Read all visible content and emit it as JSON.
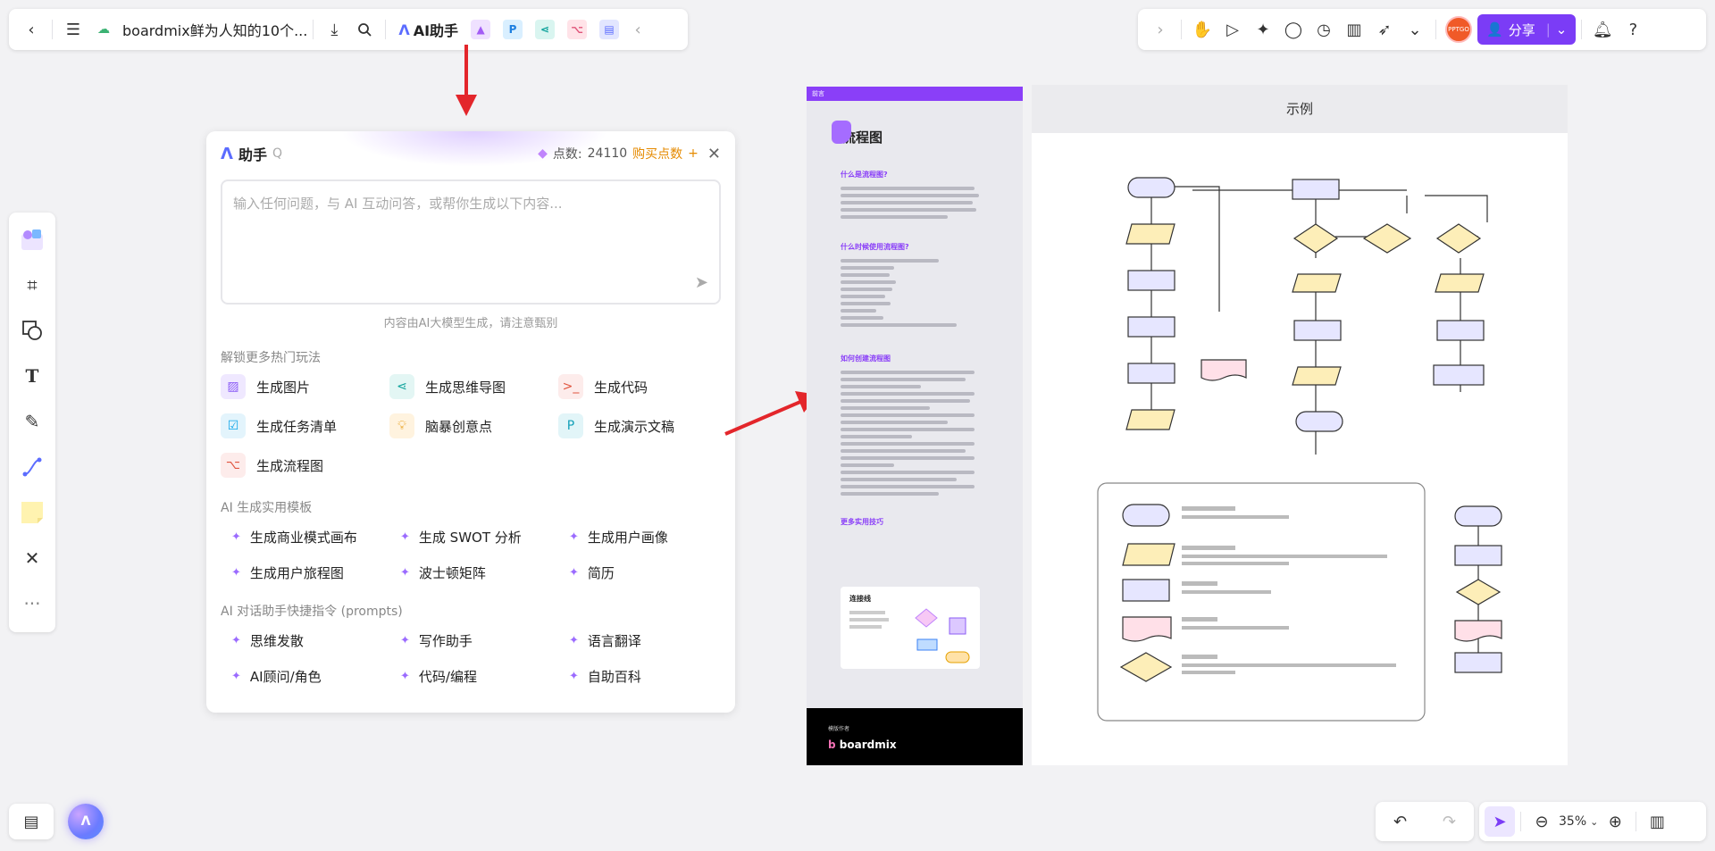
{
  "topbar": {
    "doc_title": "boardmix鲜为人知的10个...",
    "ai_label": "AI助手",
    "share_label": "分享",
    "avatar_text": "PPTGO"
  },
  "ai_panel": {
    "title": "助手",
    "points_label": "点数:",
    "points_value": "24110",
    "buy_label": "购买点数",
    "input_placeholder": "输入任何问题，与 AI 互动问答，或帮你生成以下内容...",
    "disclaimer": "内容由AI大模型生成，请注意甄别",
    "section_hot": "解锁更多热门玩法",
    "hot_items": [
      {
        "label": "生成图片",
        "icon": "image-icon",
        "color": "#8b5cf6",
        "bg": "#efe8ff"
      },
      {
        "label": "生成思维导图",
        "icon": "mindmap-icon",
        "color": "#10a39c",
        "bg": "#e3f6f4"
      },
      {
        "label": "生成代码",
        "icon": "code-icon",
        "color": "#e0553f",
        "bg": "#fdeceb"
      },
      {
        "label": "生成任务清单",
        "icon": "checklist-icon",
        "color": "#0ea5e9",
        "bg": "#e3f4fc"
      },
      {
        "label": "脑暴创意点",
        "icon": "bulb-icon",
        "color": "#e79b10",
        "bg": "#fff3df"
      },
      {
        "label": "生成演示文稿",
        "icon": "presentation-icon",
        "color": "#14a0b8",
        "bg": "#e2f5f8"
      },
      {
        "label": "生成流程图",
        "icon": "flowchart-icon",
        "color": "#e0553f",
        "bg": "#fdeceb"
      }
    ],
    "section_templates": "AI 生成实用模板",
    "templates": [
      "生成商业模式画布",
      "生成 SWOT 分析",
      "生成用户画像",
      "生成用户旅程图",
      "波士顿矩阵",
      "简历"
    ],
    "section_prompts": "AI 对话助手快捷指令 (prompts)",
    "prompts": [
      "思维发散",
      "写作助手",
      "语言翻译",
      "AI顾问/角色",
      "代码/编程",
      "自助百科"
    ]
  },
  "canvas": {
    "doc_header": "前言",
    "doc_title": "流程图",
    "doc_sub1": "什么是流程图?",
    "doc_sub2": "什么时候使用流程图?",
    "doc_sub3": "如何创建流程图",
    "doc_sub4": "更多实用技巧",
    "card_title": "连接线",
    "footer_small": "模版作者",
    "footer_brand": "boardmix",
    "example_title": "示例"
  },
  "bottom": {
    "zoom": "35%"
  }
}
